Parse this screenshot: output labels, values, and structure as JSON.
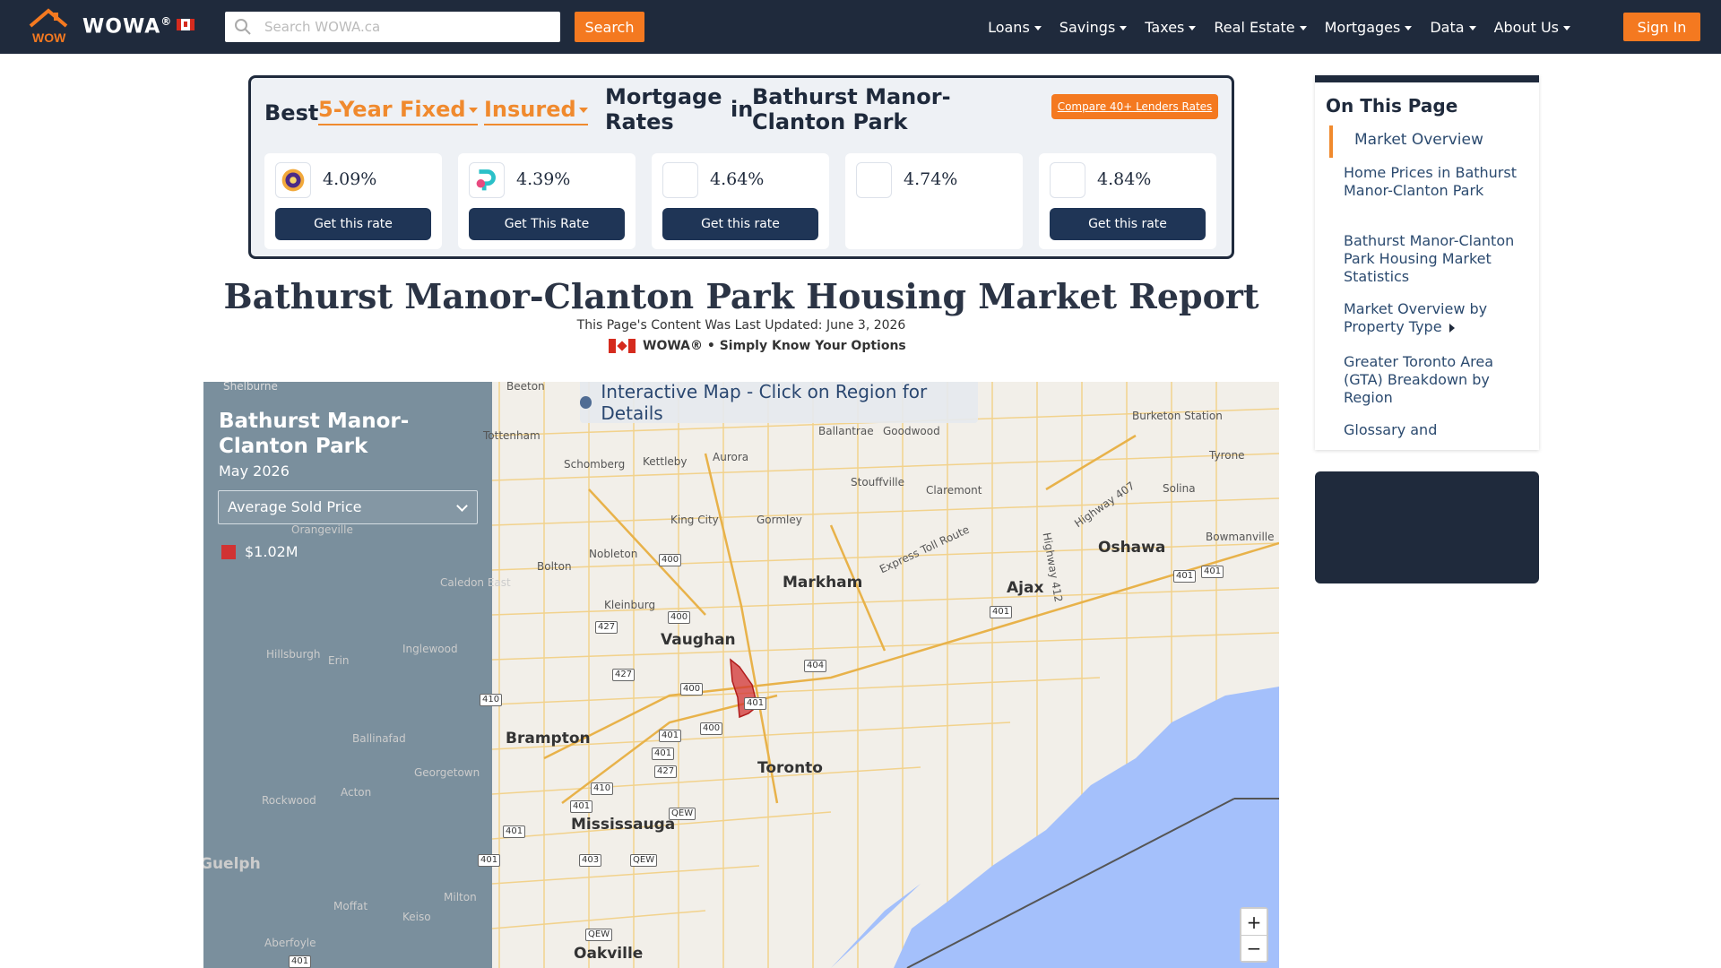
{
  "nav": {
    "brand": "WOWA",
    "brand_mark": "®",
    "search_placeholder": "Search WOWA.ca",
    "search_button": "Search",
    "links": [
      "Loans",
      "Savings",
      "Taxes",
      "Real Estate",
      "Mortgages",
      "Data",
      "About Us"
    ],
    "signin": "Sign In"
  },
  "rates": {
    "best": "Best",
    "term": "5-Year Fixed",
    "insurance": "Insured",
    "mortgage_rates": "Mortgage Rates",
    "in": "in",
    "region": "Bathurst Manor-Clanton Park",
    "compare": "Compare 40+ Lenders Rates",
    "cards": [
      {
        "rate": "4.09%",
        "button": "Get this rate"
      },
      {
        "rate": "4.39%",
        "button": "Get This Rate"
      },
      {
        "rate": "4.64%",
        "button": "Get this rate"
      },
      {
        "rate": "4.74%",
        "button": ""
      },
      {
        "rate": "4.84%",
        "button": "Get this rate"
      }
    ]
  },
  "page": {
    "title": "Bathurst Manor-Clanton Park Housing Market Report",
    "updated": "This Page's Content Was Last Updated: June 3, 2026",
    "tagline": "WOWA® • Simply Know Your Options"
  },
  "map": {
    "banner": "Interactive Map - Click on Region for Details",
    "region": "Bathurst Manor-Clanton Park",
    "date": "May 2026",
    "metric": "Average Sold Price",
    "legend_value": "$1.02M",
    "zoom_in": "+",
    "zoom_out": "−",
    "places": [
      "Beeton",
      "Shelburne",
      "Tottenham",
      "Schomberg",
      "Kettleby",
      "Aurora",
      "Ballantrae",
      "Goodwood",
      "Burketon Station",
      "Tyrone",
      "Stouffville",
      "Claremont",
      "Solina",
      "King City",
      "Gormley",
      "Nobleton",
      "Bolton",
      "Markham",
      "Oshawa",
      "Bowmanville",
      "Ajax",
      "Kleinburg",
      "Vaughan",
      "Brampton",
      "Toronto",
      "Mississauga",
      "Oakville",
      "Orangeville",
      "Caledon East",
      "Hillsburgh",
      "Erin",
      "Inglewood",
      "Ballinafad",
      "Georgetown",
      "Acton",
      "Rockwood",
      "Guelph",
      "Moffat",
      "Milton",
      "Aberfoyle",
      "Keiso",
      "Highway 407",
      "Express Toll Route",
      "Highway 412"
    ],
    "highways": [
      "400",
      "400",
      "427",
      "427",
      "400",
      "401",
      "404",
      "400",
      "401",
      "401",
      "427",
      "410",
      "401",
      "QEW",
      "401",
      "403",
      "QEW",
      "QEW",
      "401",
      "401",
      "401",
      "410",
      "401",
      "401"
    ]
  },
  "toc": {
    "title": "On This Page",
    "items": [
      "Market Overview",
      "Home Prices in Bathurst Manor-Clanton Park",
      "Bathurst Manor-Clanton Park Housing Market Statistics",
      "Market Overview by Property Type",
      "Greater Toronto Area (GTA) Breakdown by Region",
      "Glossary and"
    ]
  },
  "colors": {
    "navy": "#1f2a3c",
    "accent": "#f47920",
    "lake": "#a4c0fb",
    "region_fill": "#d13333"
  },
  "icons": {
    "logo": "wowa-house-logo-icon",
    "search": "magnifier-icon",
    "flag": "canada-flag-icon"
  }
}
